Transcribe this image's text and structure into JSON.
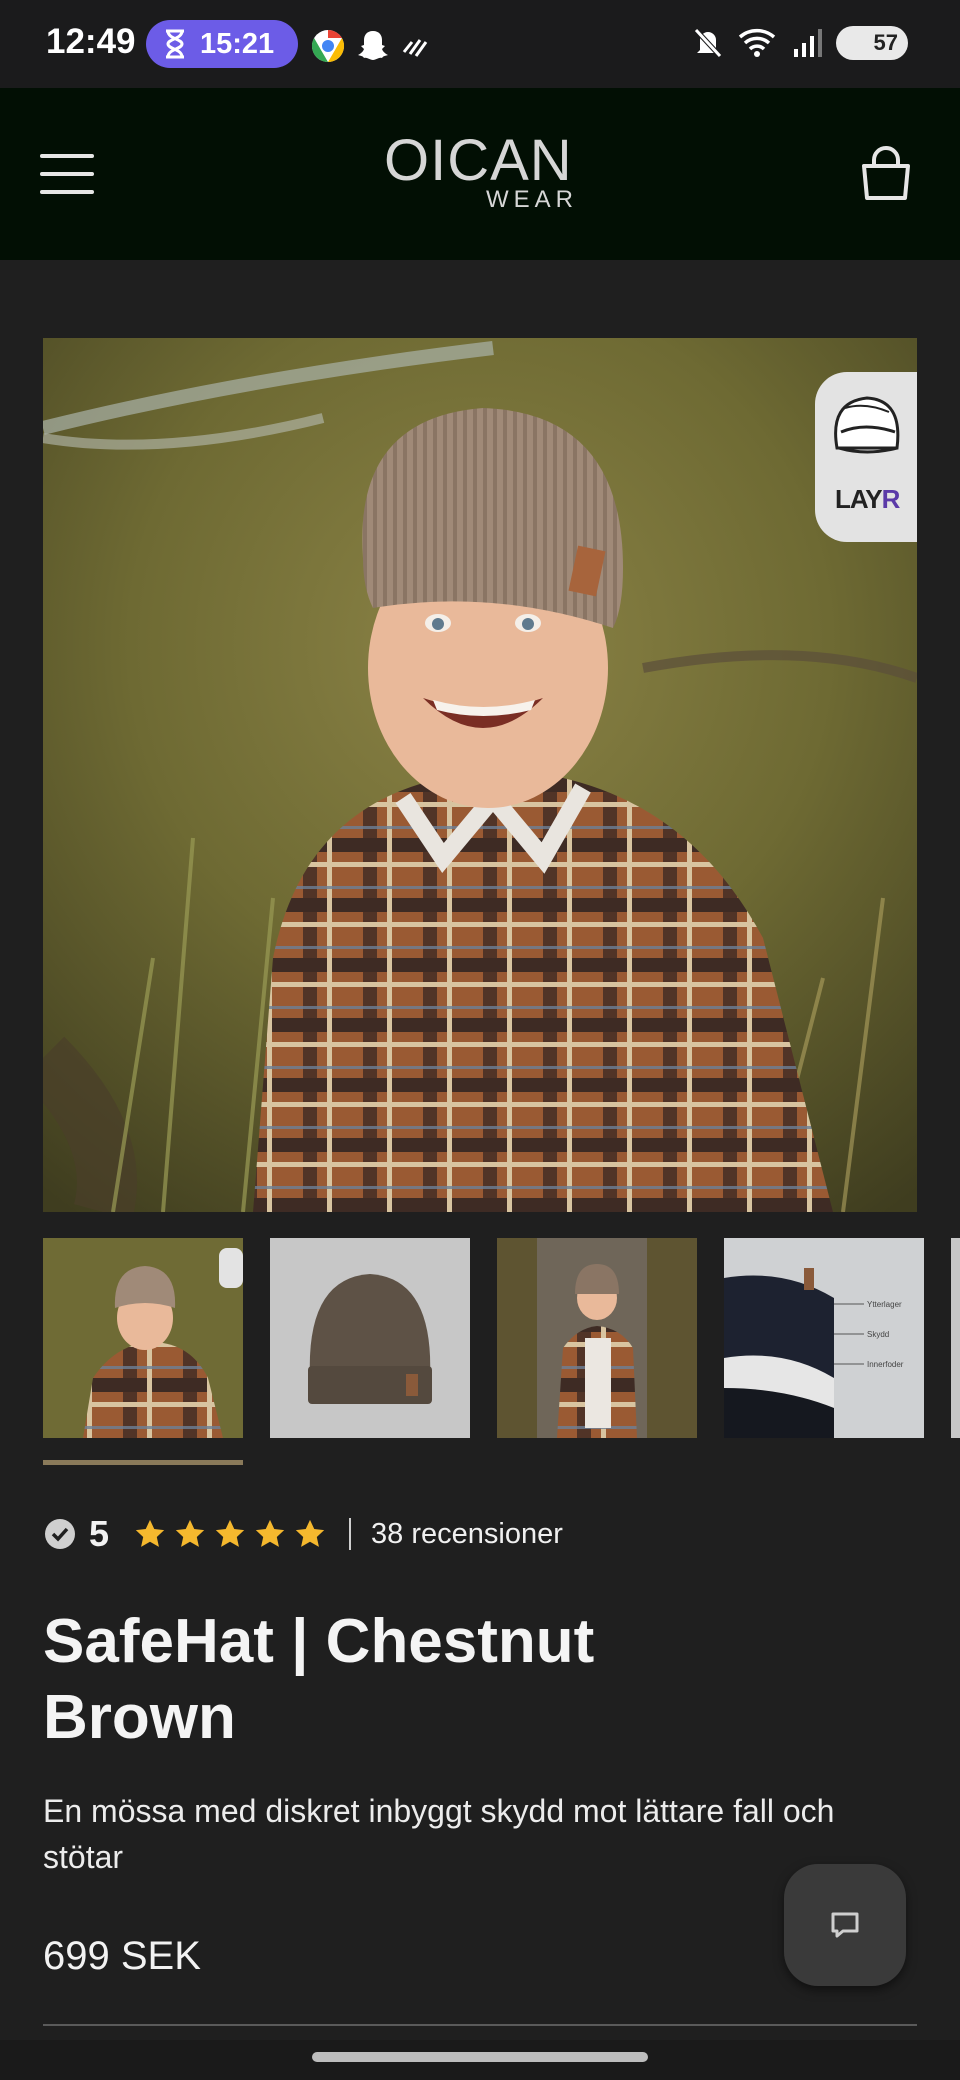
{
  "status_bar": {
    "time": "12:49",
    "timer": "15:21",
    "battery": "57",
    "icons": [
      "hourglass-icon",
      "chrome-icon",
      "snapchat-icon",
      "signal-lines-icon",
      "mute-icon",
      "wifi-icon",
      "cell-signal-icon",
      "battery-icon"
    ]
  },
  "header": {
    "logo_top": "OICAN",
    "logo_bottom": "WEAR",
    "icons": [
      "menu-icon",
      "shopping-bag-icon"
    ]
  },
  "badge": {
    "text_main": "LAY",
    "text_accent": "R"
  },
  "rating": {
    "score": "5",
    "stars": 5,
    "reviews": "38 recensioner",
    "star_color": "#f5b82e"
  },
  "product": {
    "title": "SafeHat | Chestnut Brown",
    "description": "En mössa med diskret inbyggt skydd mot lättare fall och stötar",
    "price": "699 SEK"
  },
  "thumbnails": {
    "labels": [
      "Ytterlager",
      "Skydd",
      "Innerfoder"
    ]
  }
}
